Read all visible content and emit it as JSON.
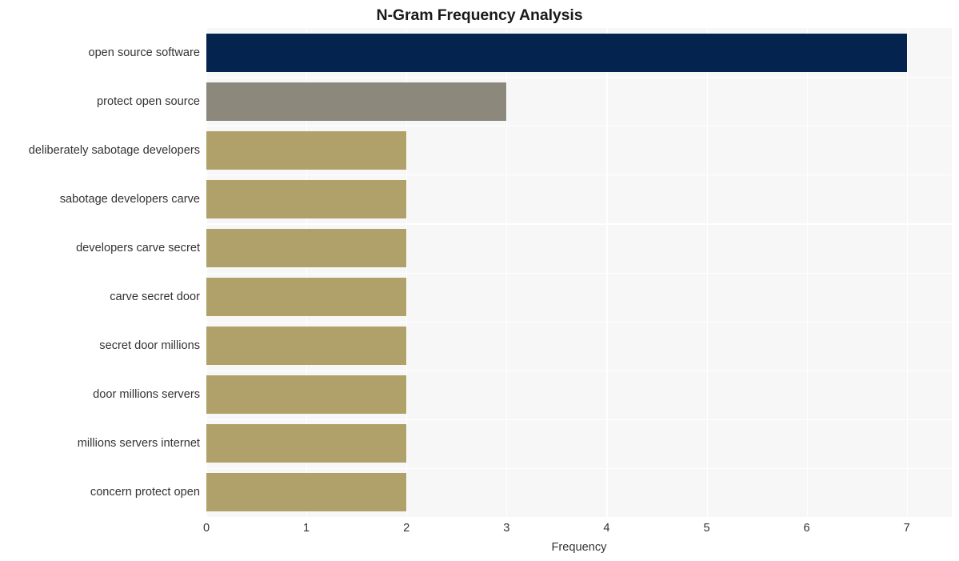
{
  "chart_data": {
    "type": "bar",
    "orientation": "horizontal",
    "title": "N-Gram Frequency Analysis",
    "xlabel": "Frequency",
    "ylabel": "",
    "xlim": [
      0,
      7.45
    ],
    "xticks": [
      "0",
      "1",
      "2",
      "3",
      "4",
      "5",
      "6",
      "7"
    ],
    "xtick_values": [
      0,
      1,
      2,
      3,
      4,
      5,
      6,
      7
    ],
    "grid": true,
    "legend": false,
    "categories": [
      "open source software",
      "protect open source",
      "deliberately sabotage developers",
      "sabotage developers carve",
      "developers carve secret",
      "carve secret door",
      "secret door millions",
      "door millions servers",
      "millions servers internet",
      "concern protect open"
    ],
    "values": [
      7,
      3,
      2,
      2,
      2,
      2,
      2,
      2,
      2,
      2
    ],
    "bar_colors": [
      "#04234f",
      "#8d887c",
      "#b0a16b",
      "#b0a16b",
      "#b0a16b",
      "#b0a16b",
      "#b0a16b",
      "#b0a16b",
      "#b0a16b",
      "#b0a16b"
    ],
    "plot_background": "#f7f7f7",
    "grid_color": "#ffffff",
    "figure_background": "#ffffff",
    "text_color": "#333333",
    "title_color": "#1a1a1a"
  }
}
